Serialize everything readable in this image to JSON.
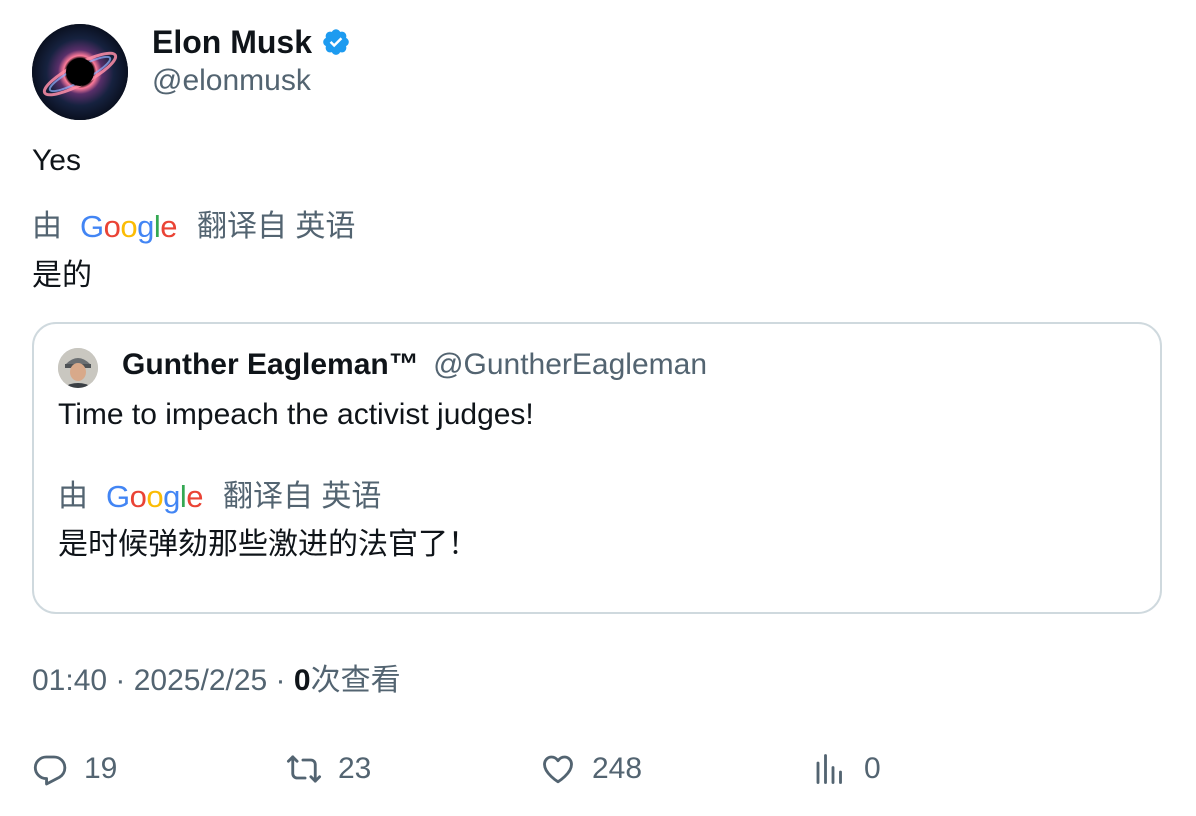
{
  "author": {
    "name": "Elon Musk",
    "handle": "@elonmusk",
    "verified_color": "#1d9bf0"
  },
  "tweet": {
    "text": "Yes",
    "translation": {
      "prefix": "由",
      "provider": "Google",
      "suffix": "翻译自 英语",
      "text": "是的"
    }
  },
  "quote": {
    "name": "Gunther Eagleman™",
    "handle": "@GuntherEagleman",
    "text": "Time to impeach the activist judges!",
    "translation": {
      "prefix": "由",
      "provider": "Google",
      "suffix": "翻译自 英语",
      "text": "是时候弹劾那些激进的法官了！"
    }
  },
  "meta": {
    "time": "01:40",
    "separator1": " · ",
    "date": "2025/2/25",
    "separator2": " · ",
    "views_count": "0",
    "views_label": "次查看"
  },
  "actions": {
    "replies": "19",
    "reposts": "23",
    "likes": "248",
    "views": "0",
    "icons": [
      "reply-icon",
      "repost-icon",
      "like-icon",
      "views-icon"
    ]
  },
  "colors": {
    "text_primary": "#0f1419",
    "text_secondary": "#536471",
    "border": "#cfd9de",
    "google_blue": "#4285f4",
    "google_red": "#ea4335",
    "google_yellow": "#fbbc05",
    "google_green": "#34a853"
  }
}
